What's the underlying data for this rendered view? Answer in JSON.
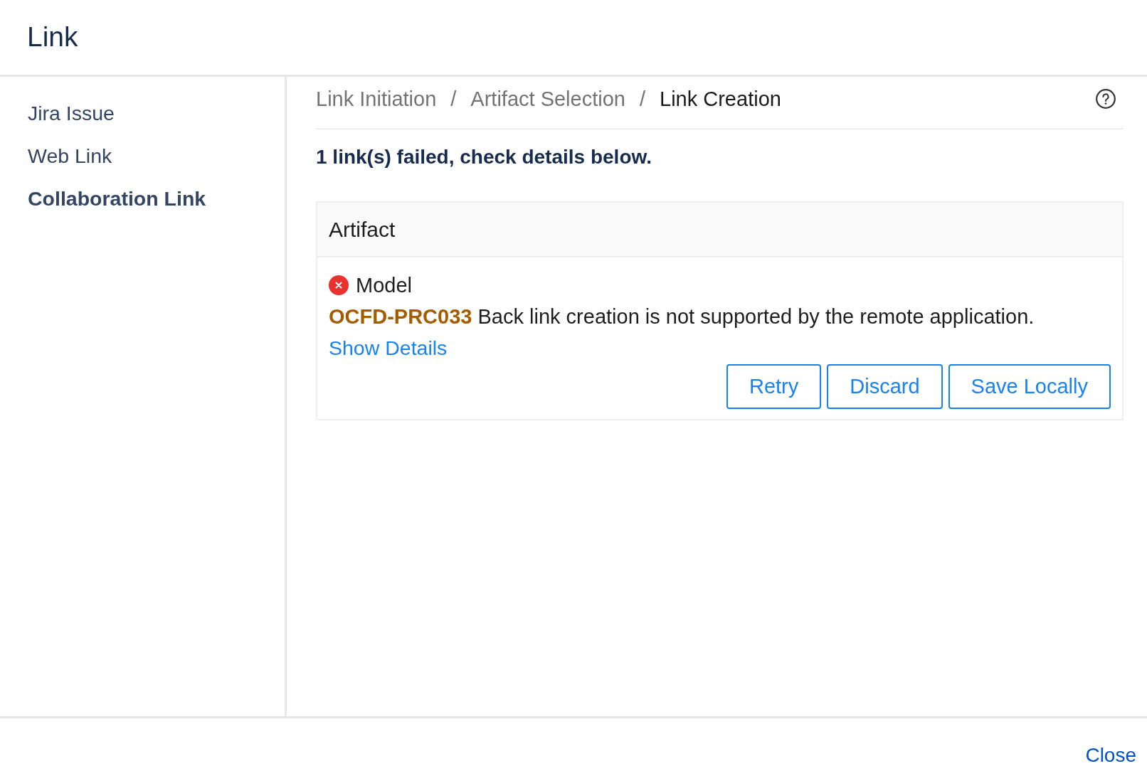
{
  "dialog": {
    "title": "Link"
  },
  "sidebar": {
    "items": [
      {
        "label": "Jira Issue",
        "selected": false
      },
      {
        "label": "Web Link",
        "selected": false
      },
      {
        "label": "Collaboration Link",
        "selected": true
      }
    ]
  },
  "breadcrumb": {
    "steps": [
      {
        "label": "Link Initiation",
        "selected": false
      },
      {
        "label": "Artifact Selection",
        "selected": false
      },
      {
        "label": "Link Creation",
        "selected": true
      }
    ],
    "separators": [
      "/",
      "/"
    ]
  },
  "message": "1 link(s) failed, check details below.",
  "artifact_table": {
    "header": "Artifact",
    "rows": [
      {
        "failed": true,
        "name": "Model",
        "error": "**OCFD-PRC033** Back link creation is not supported by the remote application.",
        "details_link": "Show Details",
        "actions": [
          "Retry",
          "Discard",
          "Save Locally"
        ]
      }
    ]
  },
  "footer": {
    "buttons": [
      "Close"
    ]
  }
}
